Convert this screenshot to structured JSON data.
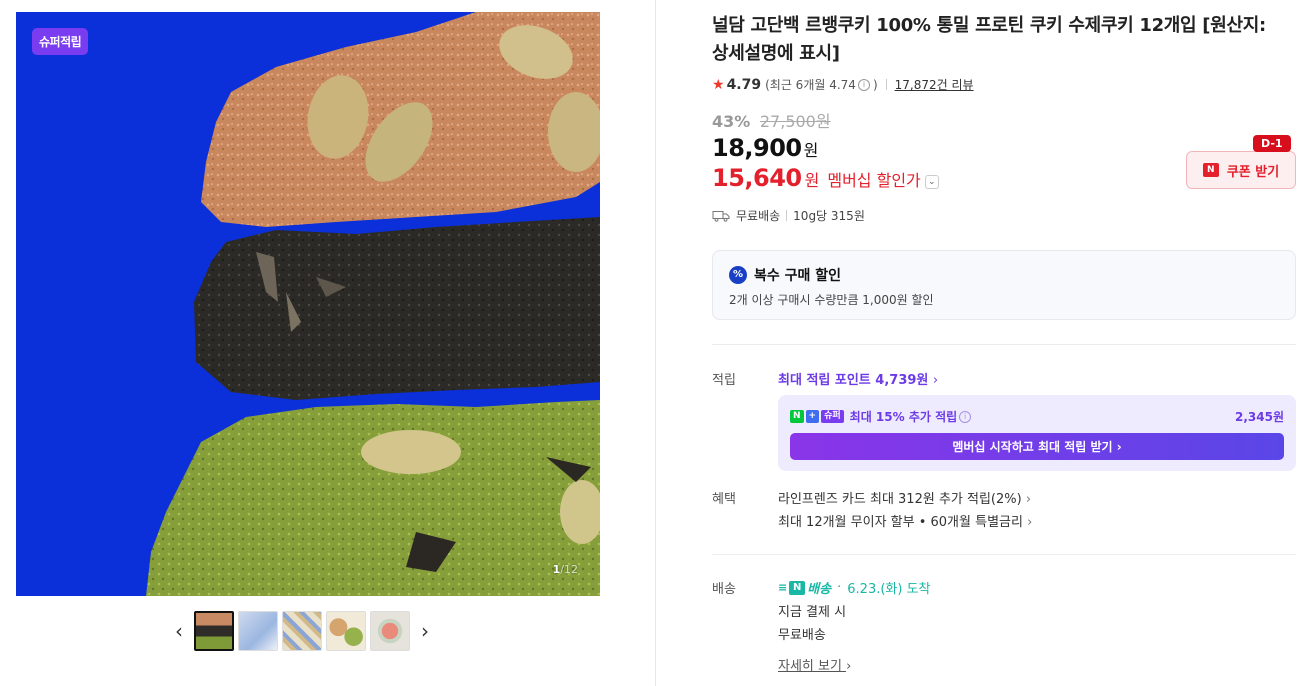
{
  "gallery": {
    "badge": "슈퍼적립",
    "page_current": "1",
    "page_total": "/12",
    "prev_icon": "‹",
    "next_icon": "›",
    "thumbnail_count": 5
  },
  "product": {
    "title": "널담 고단백 르뱅쿠키 100% 통밀 프로틴 쿠키 수제쿠키 12개입 [원산지:상세설명에 표시]",
    "rating": {
      "score": "4.79",
      "recent": "(최근 6개월 4.74",
      "recent_close": ")",
      "reviews": "17,872건 리뷰"
    },
    "discount_rate": "43%",
    "original_price": "27,500원",
    "price": "18,900",
    "price_unit": "원",
    "member_price": "15,640",
    "member_price_unit": "원",
    "member_price_label": "멤버십 할인가",
    "coupon": {
      "label": "쿠폰 받기",
      "logo": "N",
      "dday": "D-1"
    },
    "shipping": {
      "fee": "무료배송",
      "unit_price": "10g당 315원"
    }
  },
  "multi_purchase": {
    "icon": "%",
    "title": "복수 구매 할인",
    "desc": "2개 이상 구매시 수량만큼 1,000원 할인"
  },
  "points": {
    "label": "적립",
    "max_points": "최대 적립 포인트 4,739원",
    "extra": {
      "n": "N",
      "plus": "+",
      "super": "슈퍼",
      "text": "최대 15% 추가 적립",
      "amount": "2,345원"
    },
    "member_button": "멤버십 시작하고 최대 적립 받기 ›"
  },
  "benefits": {
    "label": "혜택",
    "items": [
      "라인프렌즈 카드 최대 312원 추가 적립(2%)",
      "최대 12개월 무이자 할부 • 60개월 특별금리"
    ]
  },
  "delivery": {
    "label": "배송",
    "badge": "배송",
    "badge_logo": "N",
    "date": "6.23.(화) 도착",
    "line1": "지금 결제 시",
    "line2": "무료배송",
    "detail": "자세히 보기"
  },
  "colors": {
    "accent_red": "#e3202b",
    "purple": "#6c3be6",
    "teal": "#19b7a5",
    "hero_blue": "#0b2fd8"
  }
}
